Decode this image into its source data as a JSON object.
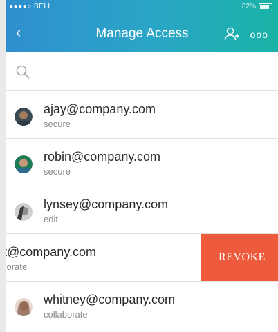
{
  "status": {
    "carrier": "●●●●○ BELL",
    "battery": "82%"
  },
  "header": {
    "title": "Manage Access",
    "back": "‹",
    "more": "ooo"
  },
  "search": {
    "placeholder": ""
  },
  "users": [
    {
      "email": "ajay@company.com",
      "role": "secure"
    },
    {
      "email": "robin@company.com",
      "role": "secure"
    },
    {
      "email": "lynsey@company.com",
      "role": "edit"
    },
    {
      "email": "nt@company.com",
      "role": "aborate",
      "revoke": "REVOKE"
    },
    {
      "email": "whitney@company.com",
      "role": "collaborate"
    }
  ],
  "colors": {
    "header_start": "#2f8fd0",
    "header_end": "#19b3a6",
    "revoke": "#ee5b3c"
  }
}
